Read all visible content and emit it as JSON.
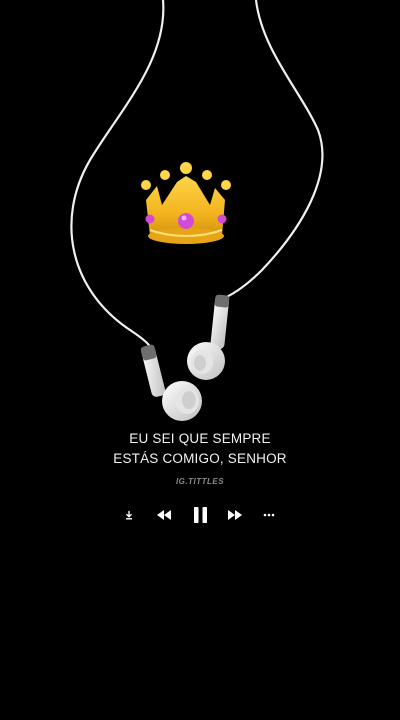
{
  "lyrics": {
    "line1": "EU SEI QUE SEMPRE",
    "line2": "ESTÁS COMIGO, SENHOR"
  },
  "credit": {
    "handle": "IG.TITTLES"
  },
  "player": {
    "state": "playing",
    "controls": [
      "download-icon",
      "previous-icon",
      "pause-icon",
      "next-icon",
      "more-icon"
    ]
  },
  "colors": {
    "background": "#000000",
    "text": "#f2f2f2",
    "handle": "#8a8a8a",
    "crown_gold": "#f2b21c",
    "crown_gems": "#d24bd6",
    "earbuds": "#d9d9d9"
  }
}
